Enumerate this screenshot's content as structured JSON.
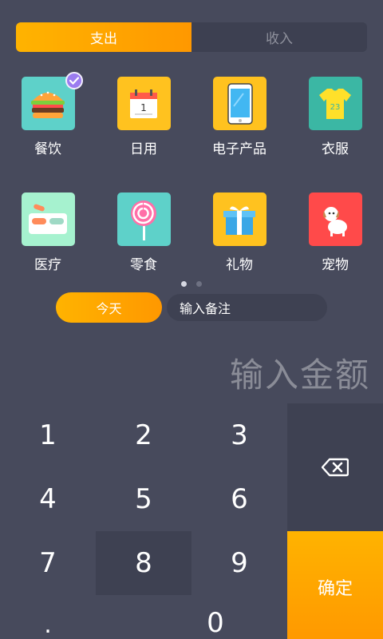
{
  "tabs": [
    {
      "label": "支出",
      "active": true
    },
    {
      "label": "收入",
      "active": false
    }
  ],
  "categories": [
    {
      "label": "餐饮",
      "icon": "burger-icon",
      "color": "#5ed1c9",
      "selected": true
    },
    {
      "label": "日用",
      "icon": "calendar-icon",
      "color": "#ffc21f",
      "selected": false
    },
    {
      "label": "电子产品",
      "icon": "phone-icon",
      "color": "#ffc21f",
      "selected": false
    },
    {
      "label": "衣服",
      "icon": "shirt-icon",
      "color": "#3bb7a4",
      "selected": false
    },
    {
      "label": "医疗",
      "icon": "pills-icon",
      "color": "#a6f2cf",
      "selected": false
    },
    {
      "label": "零食",
      "icon": "lollipop-icon",
      "color": "#5ed1c9",
      "selected": false
    },
    {
      "label": "礼物",
      "icon": "gift-icon",
      "color": "#ffc21f",
      "selected": false
    },
    {
      "label": "宠物",
      "icon": "dog-icon",
      "color": "#ff4a4a",
      "selected": false
    }
  ],
  "shirt_number": "23",
  "calendar_number": "1",
  "pager": {
    "pages": 2,
    "current": 1
  },
  "date_button": "今天",
  "note_placeholder": "输入备注",
  "amount_placeholder": "输入金额",
  "keypad": {
    "keys": [
      "1",
      "2",
      "3",
      "4",
      "5",
      "6",
      "7",
      "8",
      "9",
      ".",
      "0"
    ],
    "backspace_icon": "backspace-icon",
    "confirm_label": "确定"
  },
  "colors": {
    "background": "#474a5c",
    "accent": "#ffa800",
    "check": "#9b7cf0"
  }
}
